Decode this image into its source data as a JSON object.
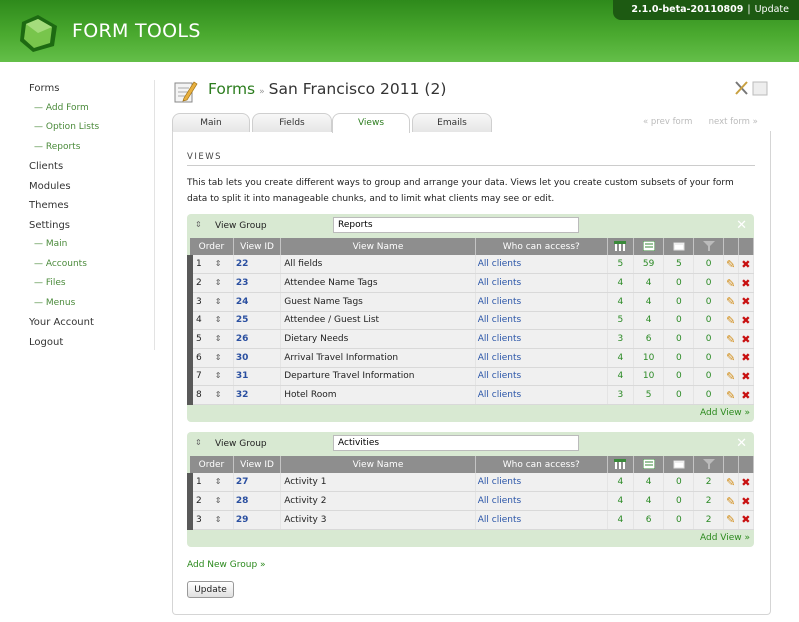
{
  "app": {
    "title": "FORM TOOLS",
    "version": "2.1.0-beta-20110809",
    "update_link": "Update",
    "separator": "|"
  },
  "nav": {
    "items": [
      {
        "label": "Forms",
        "sub": false
      },
      {
        "label": "— Add Form",
        "sub": true
      },
      {
        "label": "— Option Lists",
        "sub": true
      },
      {
        "label": "— Reports",
        "sub": true
      },
      {
        "label": "Clients",
        "sub": false
      },
      {
        "label": "Modules",
        "sub": false
      },
      {
        "label": "Themes",
        "sub": false
      },
      {
        "label": "Settings",
        "sub": false
      },
      {
        "label": "— Main",
        "sub": true
      },
      {
        "label": "— Accounts",
        "sub": true
      },
      {
        "label": "— Files",
        "sub": true
      },
      {
        "label": "— Menus",
        "sub": true
      },
      {
        "label": "Your Account",
        "sub": false
      },
      {
        "label": "Logout",
        "sub": false
      }
    ]
  },
  "page": {
    "crumb": "Forms",
    "separator": "»",
    "form_name": "San Francisco 2011 (2)"
  },
  "tabs": [
    "Main",
    "Fields",
    "Views",
    "Emails"
  ],
  "active_tab": "Views",
  "pager": {
    "prev": "« prev form",
    "next": "next form »"
  },
  "section": {
    "title": "VIEWS",
    "intro": "This tab lets you create different ways to group and arrange your data. Views let you create custom subsets of your form data to split it into manageable chunks, and to limit what clients may see or edit."
  },
  "table_headers": {
    "order": "Order",
    "view_id": "View ID",
    "view_name": "View Name",
    "who": "Who can access?"
  },
  "groups": [
    {
      "label": "View Group",
      "name": "Reports",
      "add_view": "Add View »",
      "rows": [
        {
          "order": "1",
          "id": "22",
          "name": "All fields",
          "who": "All clients",
          "c1": "5",
          "c2": "59",
          "c3": "5",
          "c4": "0"
        },
        {
          "order": "2",
          "id": "23",
          "name": "Attendee Name Tags",
          "who": "All clients",
          "c1": "4",
          "c2": "4",
          "c3": "0",
          "c4": "0"
        },
        {
          "order": "3",
          "id": "24",
          "name": "Guest Name Tags",
          "who": "All clients",
          "c1": "4",
          "c2": "4",
          "c3": "0",
          "c4": "0"
        },
        {
          "order": "4",
          "id": "25",
          "name": "Attendee / Guest List",
          "who": "All clients",
          "c1": "5",
          "c2": "4",
          "c3": "0",
          "c4": "0"
        },
        {
          "order": "5",
          "id": "26",
          "name": "Dietary Needs",
          "who": "All clients",
          "c1": "3",
          "c2": "6",
          "c3": "0",
          "c4": "0"
        },
        {
          "order": "6",
          "id": "30",
          "name": "Arrival Travel Information",
          "who": "All clients",
          "c1": "4",
          "c2": "10",
          "c3": "0",
          "c4": "0"
        },
        {
          "order": "7",
          "id": "31",
          "name": "Departure Travel Information",
          "who": "All clients",
          "c1": "4",
          "c2": "10",
          "c3": "0",
          "c4": "0"
        },
        {
          "order": "8",
          "id": "32",
          "name": "Hotel Room",
          "who": "All clients",
          "c1": "3",
          "c2": "5",
          "c3": "0",
          "c4": "0"
        }
      ]
    },
    {
      "label": "View Group",
      "name": "Activities",
      "add_view": "Add View »",
      "rows": [
        {
          "order": "1",
          "id": "27",
          "name": "Activity 1",
          "who": "All clients",
          "c1": "4",
          "c2": "4",
          "c3": "0",
          "c4": "2"
        },
        {
          "order": "2",
          "id": "28",
          "name": "Activity 2",
          "who": "All clients",
          "c1": "4",
          "c2": "4",
          "c3": "0",
          "c4": "2"
        },
        {
          "order": "3",
          "id": "29",
          "name": "Activity 3",
          "who": "All clients",
          "c1": "4",
          "c2": "6",
          "c3": "0",
          "c4": "2"
        }
      ]
    }
  ],
  "add_group": "Add New Group »",
  "update_button": "Update",
  "glyphs": {
    "arrows": "⇕",
    "close": "✕",
    "edit": "✎",
    "delete": "✖"
  },
  "colors": {
    "header_green": "#4aa92f",
    "link_green": "#2c7d1e",
    "link_blue": "#2a55a8",
    "group_bg": "#d8e9d2",
    "delete_red": "#c81010"
  }
}
